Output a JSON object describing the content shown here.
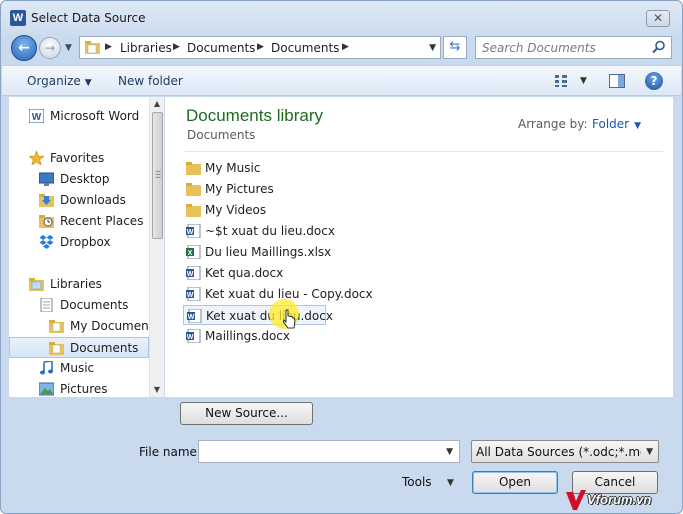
{
  "window": {
    "title": "Select Data Source",
    "app_icon": "W",
    "close_label": "✕"
  },
  "navbar": {
    "back_label": "←",
    "forward_label": "→",
    "history_caret": "▼",
    "breadcrumbs": [
      "Libraries",
      "Documents",
      "Documents"
    ],
    "refresh_label": "⇆",
    "search_placeholder": "Search Documents"
  },
  "toolbar": {
    "organize_label": "Organize",
    "new_folder_label": "New folder",
    "help_label": "?"
  },
  "sidebar": {
    "items": [
      {
        "label": "Microsoft Word",
        "icon": "word-icon"
      },
      {
        "label": "Favorites",
        "icon": "star-icon"
      },
      {
        "label": "Desktop",
        "icon": "desktop-icon"
      },
      {
        "label": "Downloads",
        "icon": "downloads-icon"
      },
      {
        "label": "Recent Places",
        "icon": "recent-places-icon"
      },
      {
        "label": "Dropbox",
        "icon": "dropbox-icon"
      },
      {
        "label": "Libraries",
        "icon": "libraries-icon"
      },
      {
        "label": "Documents",
        "icon": "documents-icon"
      },
      {
        "label": "My Documents",
        "icon": "folder-icon"
      },
      {
        "label": "Documents",
        "icon": "folder-icon",
        "selected": true
      },
      {
        "label": "Music",
        "icon": "music-icon"
      },
      {
        "label": "Pictures",
        "icon": "pictures-icon"
      }
    ]
  },
  "main": {
    "library_title": "Documents library",
    "library_subtitle": "Documents",
    "arrange_label": "Arrange by:",
    "arrange_value": "Folder",
    "files": [
      {
        "name": "My Music",
        "type": "folder"
      },
      {
        "name": "My Pictures",
        "type": "folder"
      },
      {
        "name": "My Videos",
        "type": "folder"
      },
      {
        "name": "~$t xuat du lieu.docx",
        "type": "word"
      },
      {
        "name": "Du lieu Maillings.xlsx",
        "type": "excel"
      },
      {
        "name": "Ket qua.docx",
        "type": "word"
      },
      {
        "name": "Ket xuat du lieu - Copy.docx",
        "type": "word"
      },
      {
        "name": "Ket xuat du lieu.docx",
        "type": "word",
        "selected": true
      },
      {
        "name": "Maillings.docx",
        "type": "word"
      }
    ]
  },
  "footer": {
    "new_source_label": "New Source...",
    "file_name_label": "File name:",
    "file_name_value": "",
    "filter_value": "All Data Sources (*.odc;*.mdb;*",
    "tools_label": "Tools",
    "open_label": "Open",
    "cancel_label": "Cancel"
  },
  "watermark": {
    "text": "Vforum.vn"
  },
  "colors": {
    "library_title": "#1f6b21",
    "accent": "#1e5aa8",
    "selection": "#d4e4f7",
    "cursor_highlight": "#ffec28"
  }
}
